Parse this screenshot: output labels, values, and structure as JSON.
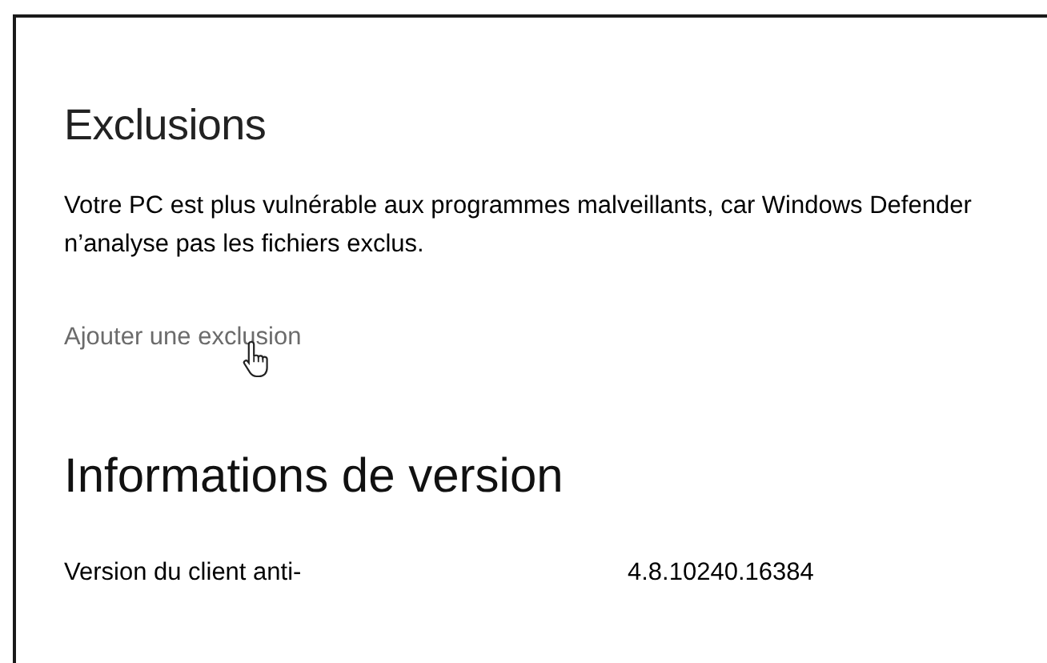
{
  "exclusions": {
    "heading": "Exclusions",
    "description": "Votre PC est plus vulnérable aux programmes malveillants, car Windows Defender n’analyse pas les fichiers exclus.",
    "link": "Ajouter une exclusion"
  },
  "version_info": {
    "heading": "Informations de version",
    "rows": [
      {
        "label": "Version du client anti-",
        "value": "4.8.10240.16384"
      }
    ]
  }
}
